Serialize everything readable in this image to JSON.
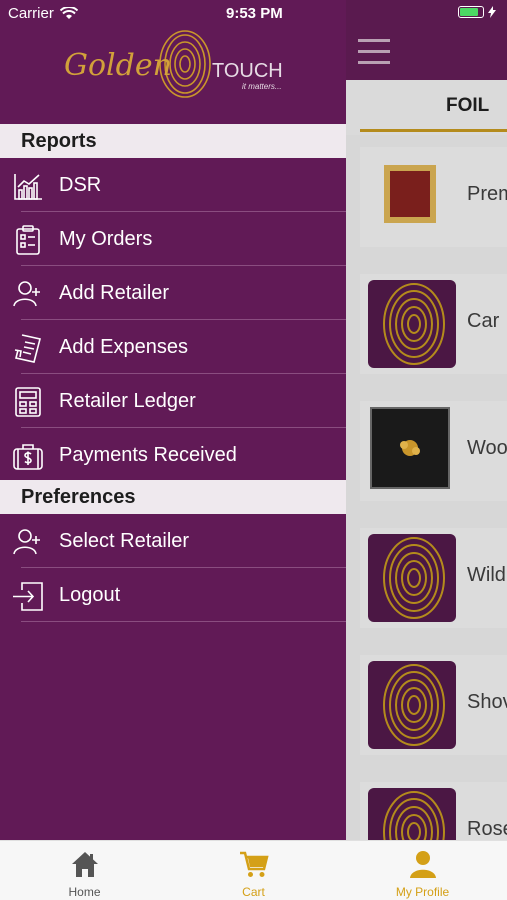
{
  "status": {
    "carrier": "Carrier",
    "time": "9:53 PM"
  },
  "logo": {
    "word1": "Golden",
    "word2": "TOUCH",
    "tagline": "it matters..."
  },
  "background": {
    "tab": "FOIL",
    "products": [
      {
        "name": "Prem",
        "thumb": "frame-gold"
      },
      {
        "name": "Car",
        "thumb": "fingerprint"
      },
      {
        "name": "Woo",
        "thumb": "frame-black"
      },
      {
        "name": "Wild",
        "thumb": "fingerprint"
      },
      {
        "name": "Shov",
        "thumb": "fingerprint"
      },
      {
        "name": "Rose",
        "thumb": "fingerprint"
      }
    ]
  },
  "drawer": {
    "reports_header": "Reports",
    "reports": [
      {
        "label": "DSR",
        "icon": "chart-icon"
      },
      {
        "label": "My Orders",
        "icon": "clipboard-icon"
      },
      {
        "label": "Add Retailer",
        "icon": "add-user-icon"
      },
      {
        "label": "Add Expenses",
        "icon": "receipt-icon"
      },
      {
        "label": "Retailer Ledger",
        "icon": "calculator-icon"
      },
      {
        "label": "Payments Received",
        "icon": "money-bag-icon"
      }
    ],
    "preferences_header": "Preferences",
    "preferences": [
      {
        "label": "Select Retailer",
        "icon": "add-user-icon"
      },
      {
        "label": "Logout",
        "icon": "logout-icon"
      }
    ]
  },
  "tabbar": {
    "items": [
      {
        "label": "Home",
        "icon": "home-icon",
        "color": "#555555"
      },
      {
        "label": "Cart",
        "icon": "cart-icon",
        "color": "#d4a017"
      },
      {
        "label": "My Profile",
        "icon": "profile-icon",
        "color": "#d4a017"
      }
    ]
  },
  "colors": {
    "drawer": "#611a56",
    "accent": "#d4a017"
  }
}
